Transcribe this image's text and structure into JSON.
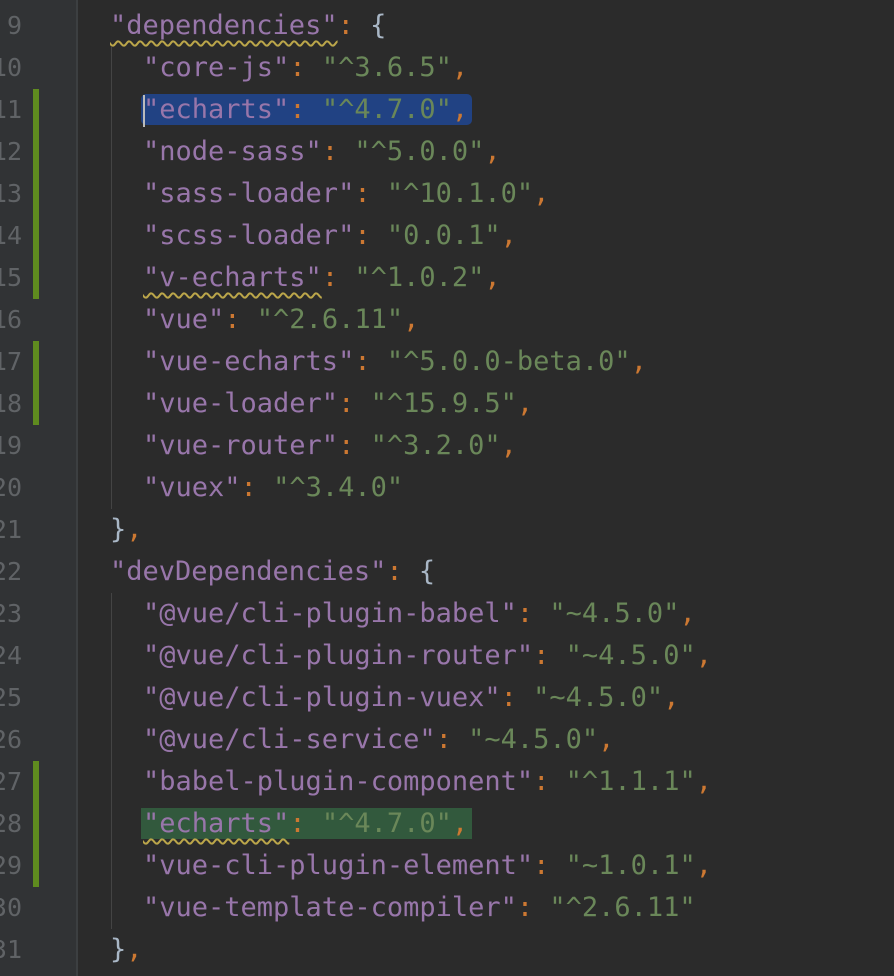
{
  "editor": {
    "lines": [
      {
        "num": "9",
        "indent": 0,
        "key": "\"dependencies\"",
        "sep": ": ",
        "open": "{",
        "warn_key": true,
        "changed": false
      },
      {
        "num": "10",
        "indent": 1,
        "key": "\"core-js\"",
        "sep": ": ",
        "val": "\"^3.6.5\"",
        "comma": ",",
        "changed": false
      },
      {
        "num": "11",
        "indent": 1,
        "key": "\"echarts\"",
        "sep": ": ",
        "val": "\"^4.7.0\"",
        "comma": ",",
        "changed": true,
        "selected": "blue",
        "caret": true
      },
      {
        "num": "12",
        "indent": 1,
        "key": "\"node-sass\"",
        "sep": ": ",
        "val": "\"^5.0.0\"",
        "comma": ",",
        "changed": true
      },
      {
        "num": "13",
        "indent": 1,
        "key": "\"sass-loader\"",
        "sep": ": ",
        "val": "\"^10.1.0\"",
        "comma": ",",
        "changed": true
      },
      {
        "num": "14",
        "indent": 1,
        "key": "\"scss-loader\"",
        "sep": ": ",
        "val": "\"0.0.1\"",
        "comma": ",",
        "changed": true
      },
      {
        "num": "15",
        "indent": 1,
        "key": "\"v-echarts\"",
        "sep": ": ",
        "val": "\"^1.0.2\"",
        "comma": ",",
        "changed": true,
        "warn_key": true
      },
      {
        "num": "16",
        "indent": 1,
        "key": "\"vue\"",
        "sep": ": ",
        "val": "\"^2.6.11\"",
        "comma": ",",
        "changed": false
      },
      {
        "num": "17",
        "indent": 1,
        "key": "\"vue-echarts\"",
        "sep": ": ",
        "val": "\"^5.0.0-beta.0\"",
        "comma": ",",
        "changed": true
      },
      {
        "num": "18",
        "indent": 1,
        "key": "\"vue-loader\"",
        "sep": ": ",
        "val": "\"^15.9.5\"",
        "comma": ",",
        "changed": true
      },
      {
        "num": "19",
        "indent": 1,
        "key": "\"vue-router\"",
        "sep": ": ",
        "val": "\"^3.2.0\"",
        "comma": ",",
        "changed": false
      },
      {
        "num": "20",
        "indent": 1,
        "key": "\"vuex\"",
        "sep": ": ",
        "val": "\"^3.4.0\"",
        "comma": "",
        "changed": false
      },
      {
        "num": "21",
        "indent": 0,
        "close": "}",
        "comma": ",",
        "changed": false
      },
      {
        "num": "22",
        "indent": 0,
        "key": "\"devDependencies\"",
        "sep": ": ",
        "open": "{",
        "changed": false
      },
      {
        "num": "23",
        "indent": 1,
        "key": "\"@vue/cli-plugin-babel\"",
        "sep": ": ",
        "val": "\"~4.5.0\"",
        "comma": ",",
        "changed": false
      },
      {
        "num": "24",
        "indent": 1,
        "key": "\"@vue/cli-plugin-router\"",
        "sep": ": ",
        "val": "\"~4.5.0\"",
        "comma": ",",
        "changed": false
      },
      {
        "num": "25",
        "indent": 1,
        "key": "\"@vue/cli-plugin-vuex\"",
        "sep": ": ",
        "val": "\"~4.5.0\"",
        "comma": ",",
        "changed": false
      },
      {
        "num": "26",
        "indent": 1,
        "key": "\"@vue/cli-service\"",
        "sep": ": ",
        "val": "\"~4.5.0\"",
        "comma": ",",
        "changed": false
      },
      {
        "num": "27",
        "indent": 1,
        "key": "\"babel-plugin-component\"",
        "sep": ": ",
        "val": "\"^1.1.1\"",
        "comma": ",",
        "changed": true
      },
      {
        "num": "28",
        "indent": 1,
        "key": "\"echarts\"",
        "sep": ": ",
        "val": "\"^4.7.0\"",
        "comma": ",",
        "changed": true,
        "selected": "green",
        "warn_key": true
      },
      {
        "num": "29",
        "indent": 1,
        "key": "\"vue-cli-plugin-element\"",
        "sep": ": ",
        "val": "\"~1.0.1\"",
        "comma": ",",
        "changed": true
      },
      {
        "num": "30",
        "indent": 1,
        "key": "\"vue-template-compiler\"",
        "sep": ": ",
        "val": "\"^2.6.11\"",
        "comma": "",
        "changed": false
      },
      {
        "num": "31",
        "indent": 0,
        "close": "}",
        "comma": ",",
        "changed": false
      }
    ]
  },
  "colors": {
    "background": "#2b2b2b",
    "gutter": "#313335",
    "line_number": "#606366",
    "key": "#9876aa",
    "string": "#6a8759",
    "punctuation": "#cc7832",
    "brace": "#a9b7c6",
    "vcs_changed": "#5f8b1f",
    "selection_blue": "#214283",
    "selection_green": "#32593d",
    "warning_underline": "#bba64a"
  }
}
